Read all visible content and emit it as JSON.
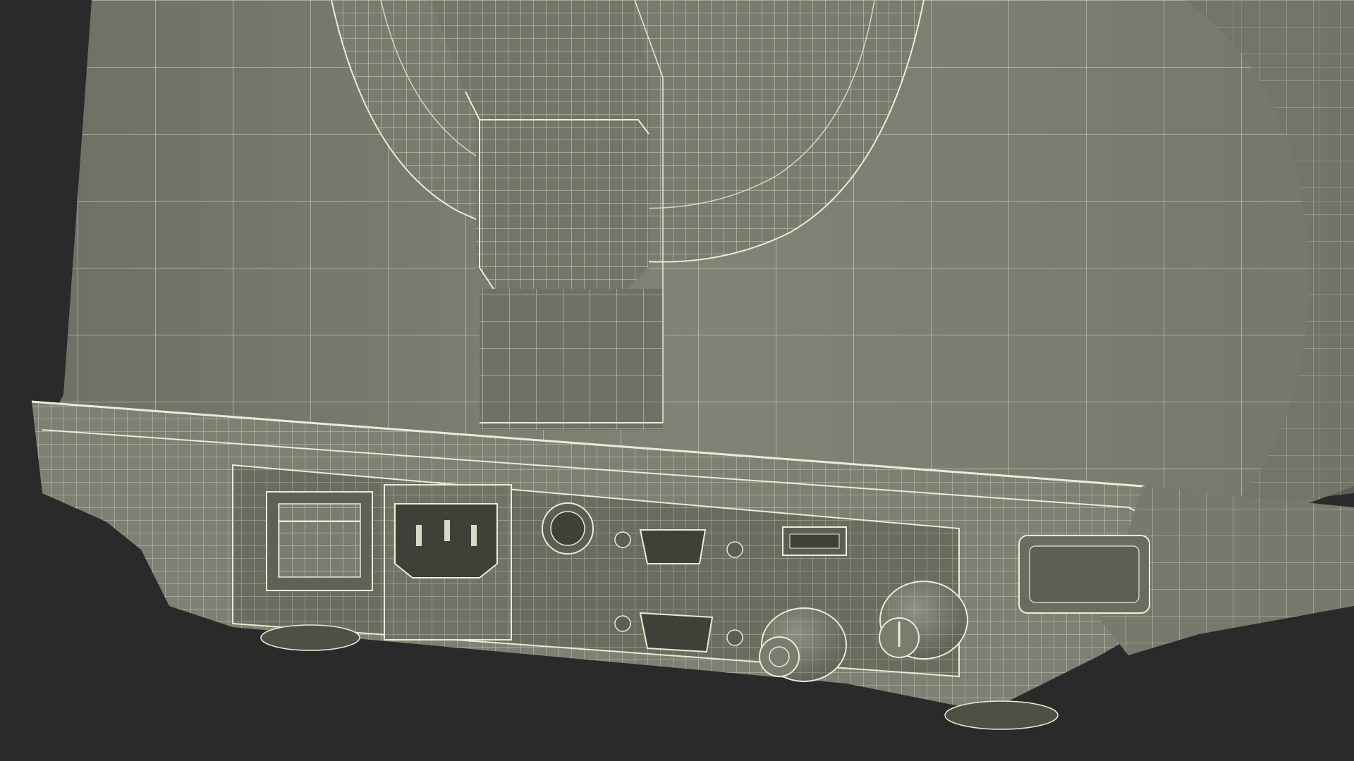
{
  "scene": {
    "subject": "device-back-panel-wireframe",
    "colors": {
      "background": "#2a2a2a",
      "surface": "#7b7d71",
      "surface_light": "#86887c",
      "surface_dark": "#66685c",
      "shadow": "#4e5046",
      "wire": "#e9ecd6",
      "port_dark": "#3f4139"
    },
    "components": [
      {
        "id": "rocker-switch",
        "kind": "power switch"
      },
      {
        "id": "iec-power-inlet",
        "kind": "power connector"
      },
      {
        "id": "round-port",
        "kind": "circular connector"
      },
      {
        "id": "db9-port-top",
        "kind": "serial connector"
      },
      {
        "id": "db9-port-bottom",
        "kind": "serial connector"
      },
      {
        "id": "usb-port",
        "kind": "usb connector"
      },
      {
        "id": "knob-left",
        "kind": "rotary knob"
      },
      {
        "id": "knob-right",
        "kind": "rotary knob"
      },
      {
        "id": "side-vent",
        "kind": "recessed slot"
      }
    ]
  }
}
